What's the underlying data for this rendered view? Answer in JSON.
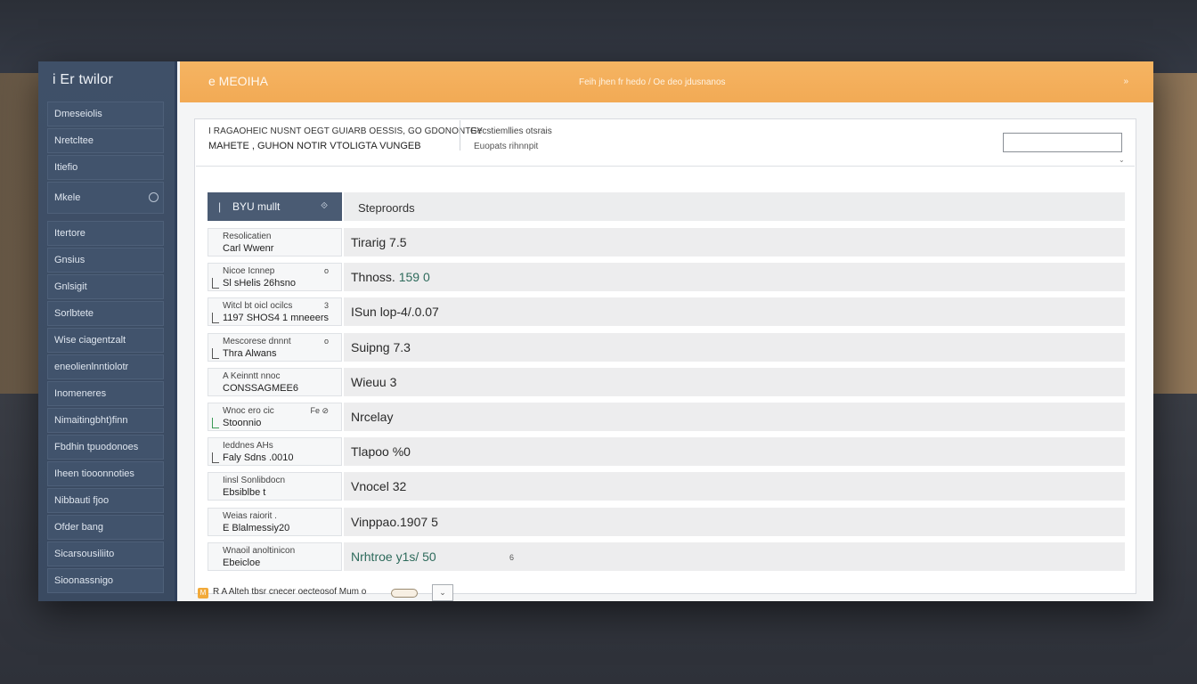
{
  "app": {
    "brand": "i Er twilor",
    "header_title": "e MEOIHA",
    "header_center": "Feih jhen fr hedo / Oe deo jdusnanos",
    "header_close": "»"
  },
  "sidebar": {
    "items": [
      {
        "label": "Dmeseiolis"
      },
      {
        "label": "Nretcltee"
      },
      {
        "label": "Itiefio"
      },
      {
        "label": "Mkele"
      },
      {
        "label": "Itertore"
      },
      {
        "label": "Gnsius"
      },
      {
        "label": "Gnlsigit"
      },
      {
        "label": "Sorlbtete"
      },
      {
        "label": "Wise ciagentzalt"
      },
      {
        "label": "eneolienlnntiolotr"
      },
      {
        "label": "Inomeneres"
      },
      {
        "label": "Nimaitingbht)finn"
      },
      {
        "label": "Fbdhin tpuodonoes"
      },
      {
        "label": "Iheen tiooonnoties"
      },
      {
        "label": "Nibbauti fjoo"
      },
      {
        "label": "Ofder bang"
      },
      {
        "label": "Sicarsousiliito"
      },
      {
        "label": "Sioonassnigo"
      }
    ]
  },
  "info": {
    "line1": "I RAGAOHEIC NUSNT OEGT GUIARB OESSIS, GO GDONONTEY",
    "line2": "MAHETE , GUHON NOTIR VTOLIGTA   VUNGEB",
    "right1": "Gecstiemllies otsrais",
    "right2": "Euopats rihnnpit",
    "input_value": "",
    "scroll": "⌄"
  },
  "table": {
    "head_left": "BYU mullt",
    "head_left_sort": "⟐",
    "head_right": "Steproords",
    "rows": [
      {
        "a": "Resolicatien",
        "b": "Carl Wwenr",
        "mark": "",
        "icon": false,
        "green": false,
        "value": "Tirarig",
        "num": "7.5",
        "tail": ""
      },
      {
        "a": "Nicoe Icnnep",
        "b": "Sl sHelis 26hsno",
        "mark": "o",
        "icon": true,
        "green": false,
        "value": "Thnoss.",
        "num": "159 0",
        "tail": ""
      },
      {
        "a": "Witcl bt oicl ocilcs",
        "b": "1197 SHOS4 1 mneeers",
        "mark": "3",
        "icon": true,
        "green": false,
        "value": "ISun lop-4/.0.07",
        "num": "",
        "tail": ""
      },
      {
        "a": "Mescorese dnnnt",
        "b": "Thra Alwans",
        "mark": "o",
        "icon": true,
        "green": false,
        "value": "Suipng",
        "num": "7.3",
        "tail": ""
      },
      {
        "a": "A Keinntt nnoc",
        "b": "CONSSAGMEE6",
        "mark": "",
        "icon": false,
        "green": false,
        "value": "Wieuu",
        "num": "3",
        "tail": ""
      },
      {
        "a": "Wnoc ero cic",
        "b": "Stoonnio",
        "mark": "Fe ⊘",
        "icon": true,
        "green": true,
        "value": "Nrcelay",
        "num": "",
        "tail": ""
      },
      {
        "a": "Ieddnes AHs",
        "b": "Faly Sdns .0010",
        "mark": "",
        "icon": true,
        "green": false,
        "value": "Tlapoo",
        "num": "%0",
        "tail": ""
      },
      {
        "a": "Iinsl Sonlibdocn",
        "b": "Ebsiblbe t",
        "mark": "",
        "icon": false,
        "green": false,
        "value": "Vnocel",
        "num": "32",
        "tail": ""
      },
      {
        "a": "Weias raiorit .",
        "b": "E Blalmessiy20",
        "mark": "",
        "icon": false,
        "green": false,
        "value": "Vinppao.1907",
        "num": "5",
        "tail": ""
      },
      {
        "a": "Wnaoil anoltinicon",
        "b": "Ebeicloe",
        "mark": "",
        "icon": false,
        "green": false,
        "value": "Nrhtroe",
        "num": "y1s/ 50",
        "tail": "6"
      }
    ]
  },
  "footer": {
    "badge": "M",
    "text": "R A Alteh tbsr cnecer oecteosof Mum o",
    "button": "⌄"
  },
  "colors": {
    "accent": "#f2aa55",
    "sidebar": "#3f5068",
    "table_header": "#4a5b73"
  }
}
